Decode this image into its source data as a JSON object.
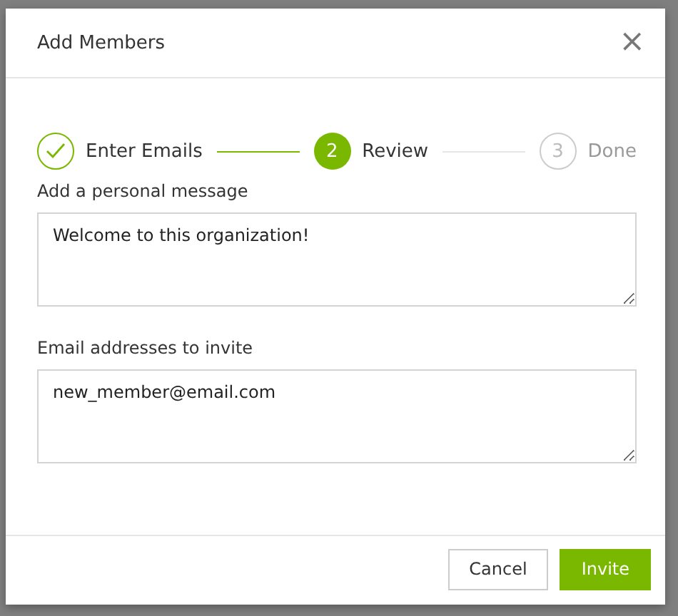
{
  "dialog": {
    "title": "Add Members",
    "close": "×"
  },
  "steps": [
    {
      "label": "Enter Emails",
      "completed": true,
      "selected": false
    },
    {
      "number": "2",
      "label": "Review",
      "completed": false,
      "selected": true
    },
    {
      "number": "3",
      "label": "Done",
      "completed": false,
      "selected": false
    }
  ],
  "fields": [
    {
      "label": "Add a personal message",
      "value": "Welcome to this organization!"
    },
    {
      "label": "Email addresses to invite",
      "value": "new_member@email.com"
    }
  ],
  "buttons": [
    {
      "label": "Cancel",
      "kind": "secondary"
    },
    {
      "label": "Invite",
      "kind": "primary"
    }
  ]
}
